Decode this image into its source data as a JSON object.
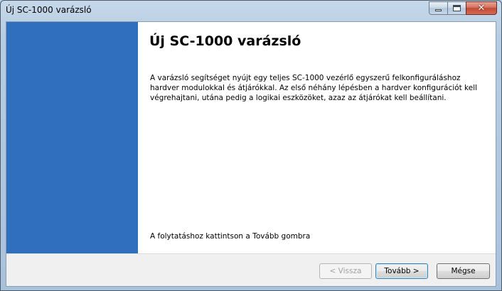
{
  "window": {
    "title": "Új SC-1000 varázsló",
    "controls": {
      "minimize_icon": "minimize-icon",
      "maximize_icon": "maximize-icon",
      "close_icon": "close-icon",
      "close_glyph": "✕"
    }
  },
  "colors": {
    "sidebar": "#2f6fbd",
    "close_button": "#c24a36"
  },
  "wizard": {
    "heading": "Új SC-1000 varázsló",
    "description": "A varázsló segítséget nyújt egy teljes SC-1000 vezérlő egyszerű felkonfiguráláshoz hardver modulokkal és átjárókkal. Az első néhány lépésben a hardver konfigurációt kell végrehajtani, utána pedig a logikai eszközöket, azaz az átjárókat kell beállítani.",
    "hint": "A folytatáshoz kattintson a Tovább gombra"
  },
  "buttons": {
    "back": "< Vissza",
    "next": "Tovább >",
    "cancel": "Mégse"
  }
}
